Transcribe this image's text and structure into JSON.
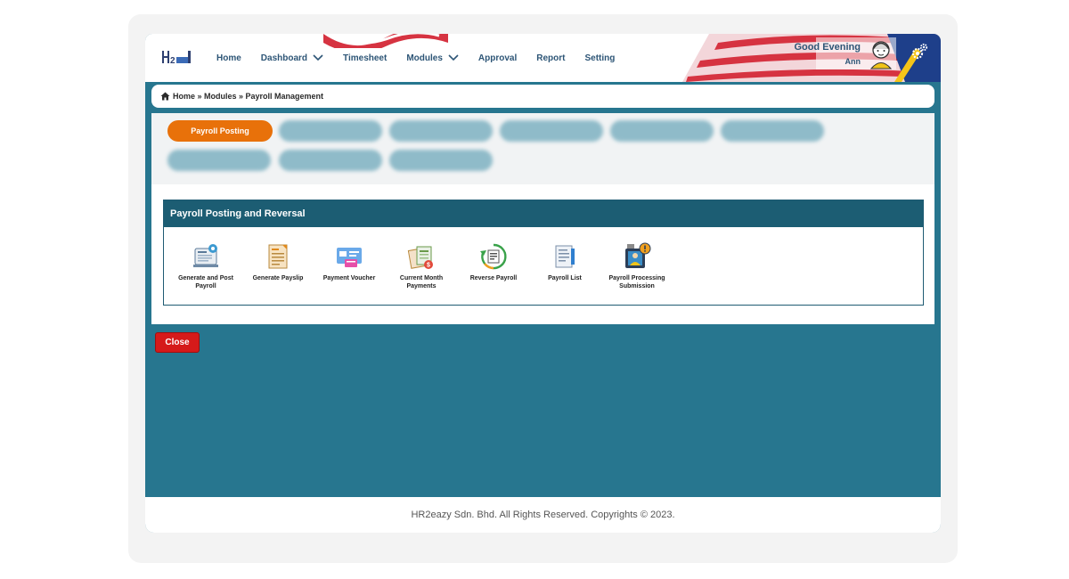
{
  "header": {
    "nav": [
      {
        "label": "Home",
        "dropdown": false
      },
      {
        "label": "Dashboard",
        "dropdown": true
      },
      {
        "label": "Timesheet",
        "dropdown": false
      },
      {
        "label": "Modules",
        "dropdown": true
      },
      {
        "label": "Approval",
        "dropdown": false
      },
      {
        "label": "Report",
        "dropdown": false
      },
      {
        "label": "Setting",
        "dropdown": false
      }
    ],
    "greeting": "Good Evening",
    "user_name": "Ann"
  },
  "breadcrumb": "Home » Modules » Payroll Management",
  "tabs": {
    "active_label": "Payroll Posting"
  },
  "section": {
    "title": "Payroll Posting and Reversal",
    "modules": [
      {
        "label": "Generate and Post Payroll",
        "icon": "generate-post-payroll-icon"
      },
      {
        "label": "Generate Payslip",
        "icon": "payslip-icon"
      },
      {
        "label": "Payment Voucher",
        "icon": "payment-voucher-icon"
      },
      {
        "label": "Current Month Payments",
        "icon": "current-month-payments-icon"
      },
      {
        "label": "Reverse Payroll",
        "icon": "reverse-payroll-icon"
      },
      {
        "label": "Payroll List",
        "icon": "payroll-list-icon"
      },
      {
        "label": "Payroll Processing Submission",
        "icon": "payroll-processing-submission-icon"
      }
    ]
  },
  "close_label": "Close",
  "footer": "HR2eazy Sdn. Bhd. All Rights Reserved. Copyrights © 2023.",
  "colors": {
    "primary": "#27768f",
    "header_bar": "#1c5d73",
    "active_tab": "#e8710a",
    "close": "#d51a1a"
  }
}
